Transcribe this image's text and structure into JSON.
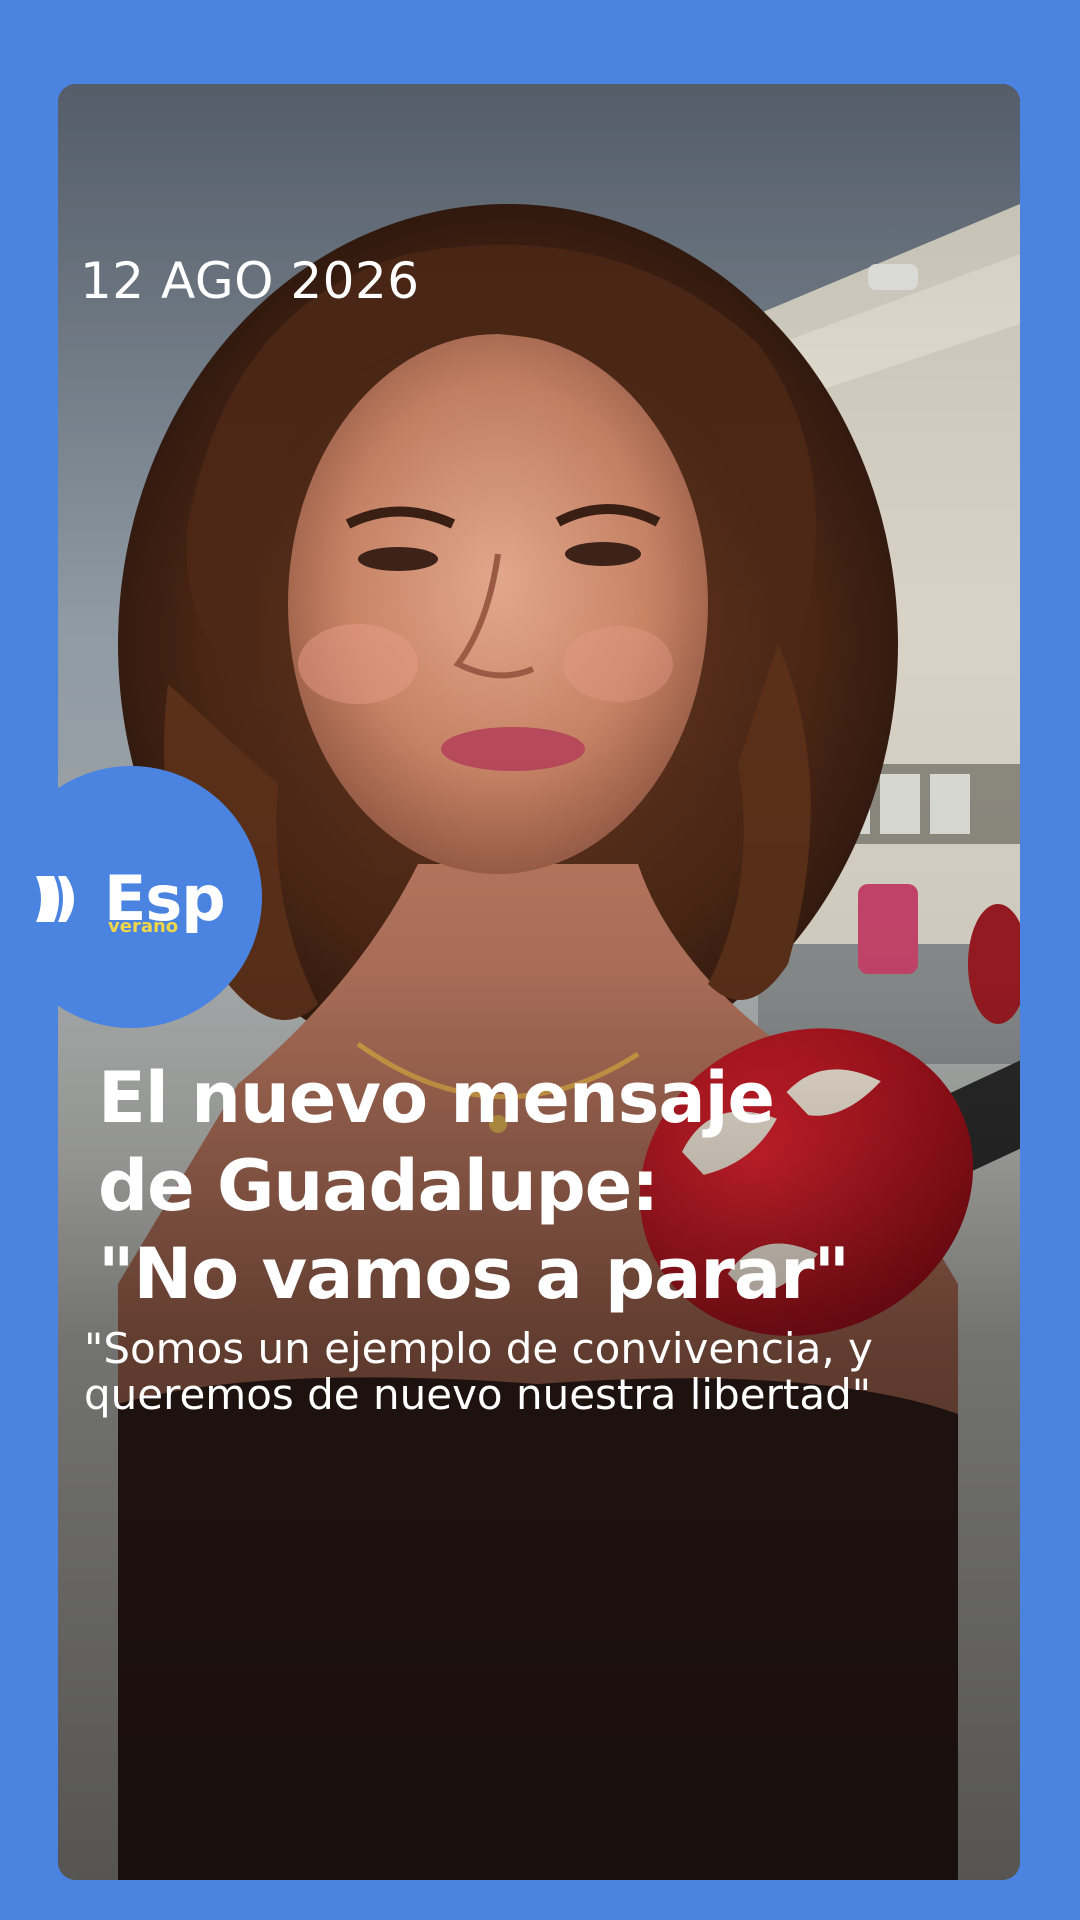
{
  "story": {
    "date": "12 AGO 2026",
    "title_lines": [
      "El nuevo mensaje",
      "de Guadalupe:",
      "\"No vamos a parar\""
    ],
    "quote_lines": [
      "\"Somos un ejemplo de convivencia, y",
      "queremos de nuevo nuestra libertad\""
    ]
  },
  "logo": {
    "brand": "Esp",
    "subtitle": "verano",
    "icon": "fast-forward-icon"
  },
  "colors": {
    "background": "#4a84e0",
    "logo_subtitle": "#f1d64a",
    "text": "#ffffff"
  }
}
